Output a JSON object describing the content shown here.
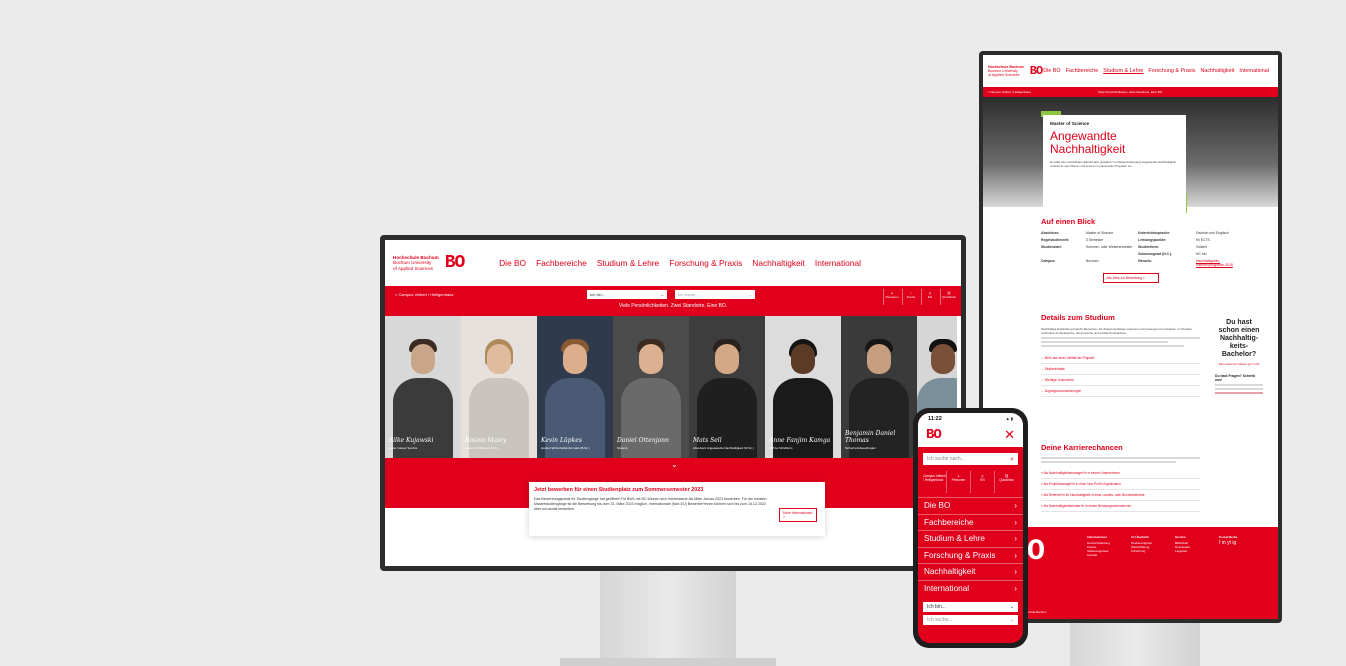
{
  "brand": {
    "line1": "Hochschule Bochum",
    "line2": "Bochum University",
    "line3": "of Applied Sciences",
    "mark": "BO"
  },
  "desktop": {
    "nav": [
      "Die BO",
      "Fachbereiche",
      "Studium & Lehre",
      "Forschung & Praxis",
      "Nachhaltigkeit",
      "International"
    ],
    "breadcrumb": "< Campus Velbert / Heiligenhaus",
    "select_role": "Ich bin...",
    "select_search": "Ich suche...",
    "tagline": "Viele Persönlichkeiten. Zwei Standorte. Eine BO.",
    "icons": [
      "Personen",
      "Suche",
      "EN",
      "Quicklinks"
    ],
    "people": [
      {
        "name": "Silke Kujawski",
        "role": "Leiter Career Service"
      },
      {
        "name": "Rosina Masry",
        "role": "studiert Architektur (B.A.)"
      },
      {
        "name": "Kevin Lüpkes",
        "role": "studiert Wirtschaftsinformatik (B.Sc.)"
      },
      {
        "name": "Daniel Ottenjann",
        "role": "Student"
      },
      {
        "name": "Mats Sell",
        "role": "Absolvent Angewandte Nachhaltigkeit (M.Sc.)"
      },
      {
        "name": "Anne Fanjim Kamga",
        "role": "QM bei Windfarm"
      },
      {
        "name": "Benjamin Daniel Thomas",
        "role": "Sicherheitsbeauftragter"
      },
      {
        "name": "",
        "role": ""
      }
    ],
    "card": {
      "title": "Jetzt bewerben für einen Studienplatz zum Sommersemester 2023",
      "text": "Das Bewerbungsportal für Studiengänge hat geöffnet! Für BWL mit NC können sich Interessierte bis Mitte Januar 2023 bewerben. Für die meisten Masterstudiengänge ist die Bewerbung bis zum 31. März 2023 möglich. Internationale (Non-EU) Bewerber*innen können sich bis zum 15.12.2022 über uni-assist bewerben.",
      "button": "Mehr Informationen >"
    }
  },
  "tall": {
    "nav": [
      "Die BO",
      "Fachbereiche",
      "Studium & Lehre",
      "Forschung & Praxis",
      "Nachhaltigkeit",
      "International"
    ],
    "breadcrumb": "< Campus Velbert / Heiligenhaus",
    "tagline": "Viele Persönlichkeiten. Zwei Standorte. Eine BO.",
    "kicker": "Master of Science",
    "title_line1": "Angewandte",
    "title_line2": "Nachhaltigkeit",
    "intro": "Du willst den nachhaltigen Wandel aktiv gestalten? Im Masterstudiengang Angewandte Nachhaltigkeit vertiefst du dein Wissen und setzt es in praxisnahen Projekten ein.",
    "glance_title": "Auf einen Blick",
    "glance": [
      [
        "Abschluss:",
        "Master of Science",
        "Unterrichtssprache:",
        "Deutsch und Englisch"
      ],
      [
        "Regelstudienzeit:",
        "3 Semester",
        "Leistungspunkte:",
        "90 ECTS"
      ],
      [
        "Studienstart:",
        "Sommer- oder Wintersemester",
        "Studienform:",
        "Vollzeit"
      ],
      [
        "",
        "",
        "Zulassungsart (N.C.):",
        "NC frei"
      ],
      [
        "Campus:",
        "Bochum",
        "Hinweis:",
        "Nachhaltigkeits-Rahmenprogramm 2018"
      ]
    ],
    "apply": "Alle Infos zur Bewerbung >",
    "details_title": "Details zum Studium",
    "details_text": "Nachhaltige Entwicklung braucht Menschen, die Zusammenhänge erkennen und Lösungen mit umsetzen. Im Studium verbindest du ökologische, ökonomische und soziale Perspektiven.",
    "accordion": [
      "Mehr aus einer Vielfalt der Projekte",
      "Studieninhalte",
      "Wichtige Dokumente",
      "Zugangsvoraussetzungen"
    ],
    "aside_big": "Du hast schon einen Nachhaltig-keits-Bachelor?",
    "aside_small": "Dann passt der Master gut zu dir",
    "questions": "Du hast Fragen? Schreib uns!",
    "career_title": "Deine Karrierechancen",
    "career_items": [
      "Als Nachhaltigkeitsmanager*in in einem Unternehmen",
      "Als Projektmanager*in in einer Non-Profit-Organisation",
      "Als Referent*in für Nachhaltigkeit in einer Landes- oder Bundesbehörde",
      "Als Nachhaltigkeitsberater*in in einem Beratungsunternehmen"
    ],
    "footer_cols": [
      {
        "head": "Informationen",
        "items": [
          "Hochschulleitung",
          "Presse",
          "Stellenangebote",
          "Kontakt"
        ]
      },
      {
        "head": "Im Überblick",
        "items": [
          "Studienangebot",
          "Weiterbildung",
          "Forschung"
        ]
      },
      {
        "head": "Service",
        "items": [
          "Bibliothek",
          "Downloads",
          "Lageplan"
        ]
      },
      {
        "head": "Social Media",
        "items": [
          "f  in  yt  ig"
        ]
      }
    ],
    "copyright": "© 2022 Hochschule Bochum"
  },
  "phone": {
    "time": "11:22",
    "status": "▲ ▮",
    "search_placeholder": "Ich suche nach...",
    "icon_labels": [
      "Campus Velbert / Heiligenhaus",
      "Personen",
      "EN",
      "Quicklinks"
    ],
    "menu": [
      "Die BO",
      "Fachbereiche",
      "Studium & Lehre",
      "Forschung & Praxis",
      "Nachhaltigkeit",
      "International"
    ],
    "select_role": "Ich bin...",
    "select_search": "Ich suche..."
  }
}
